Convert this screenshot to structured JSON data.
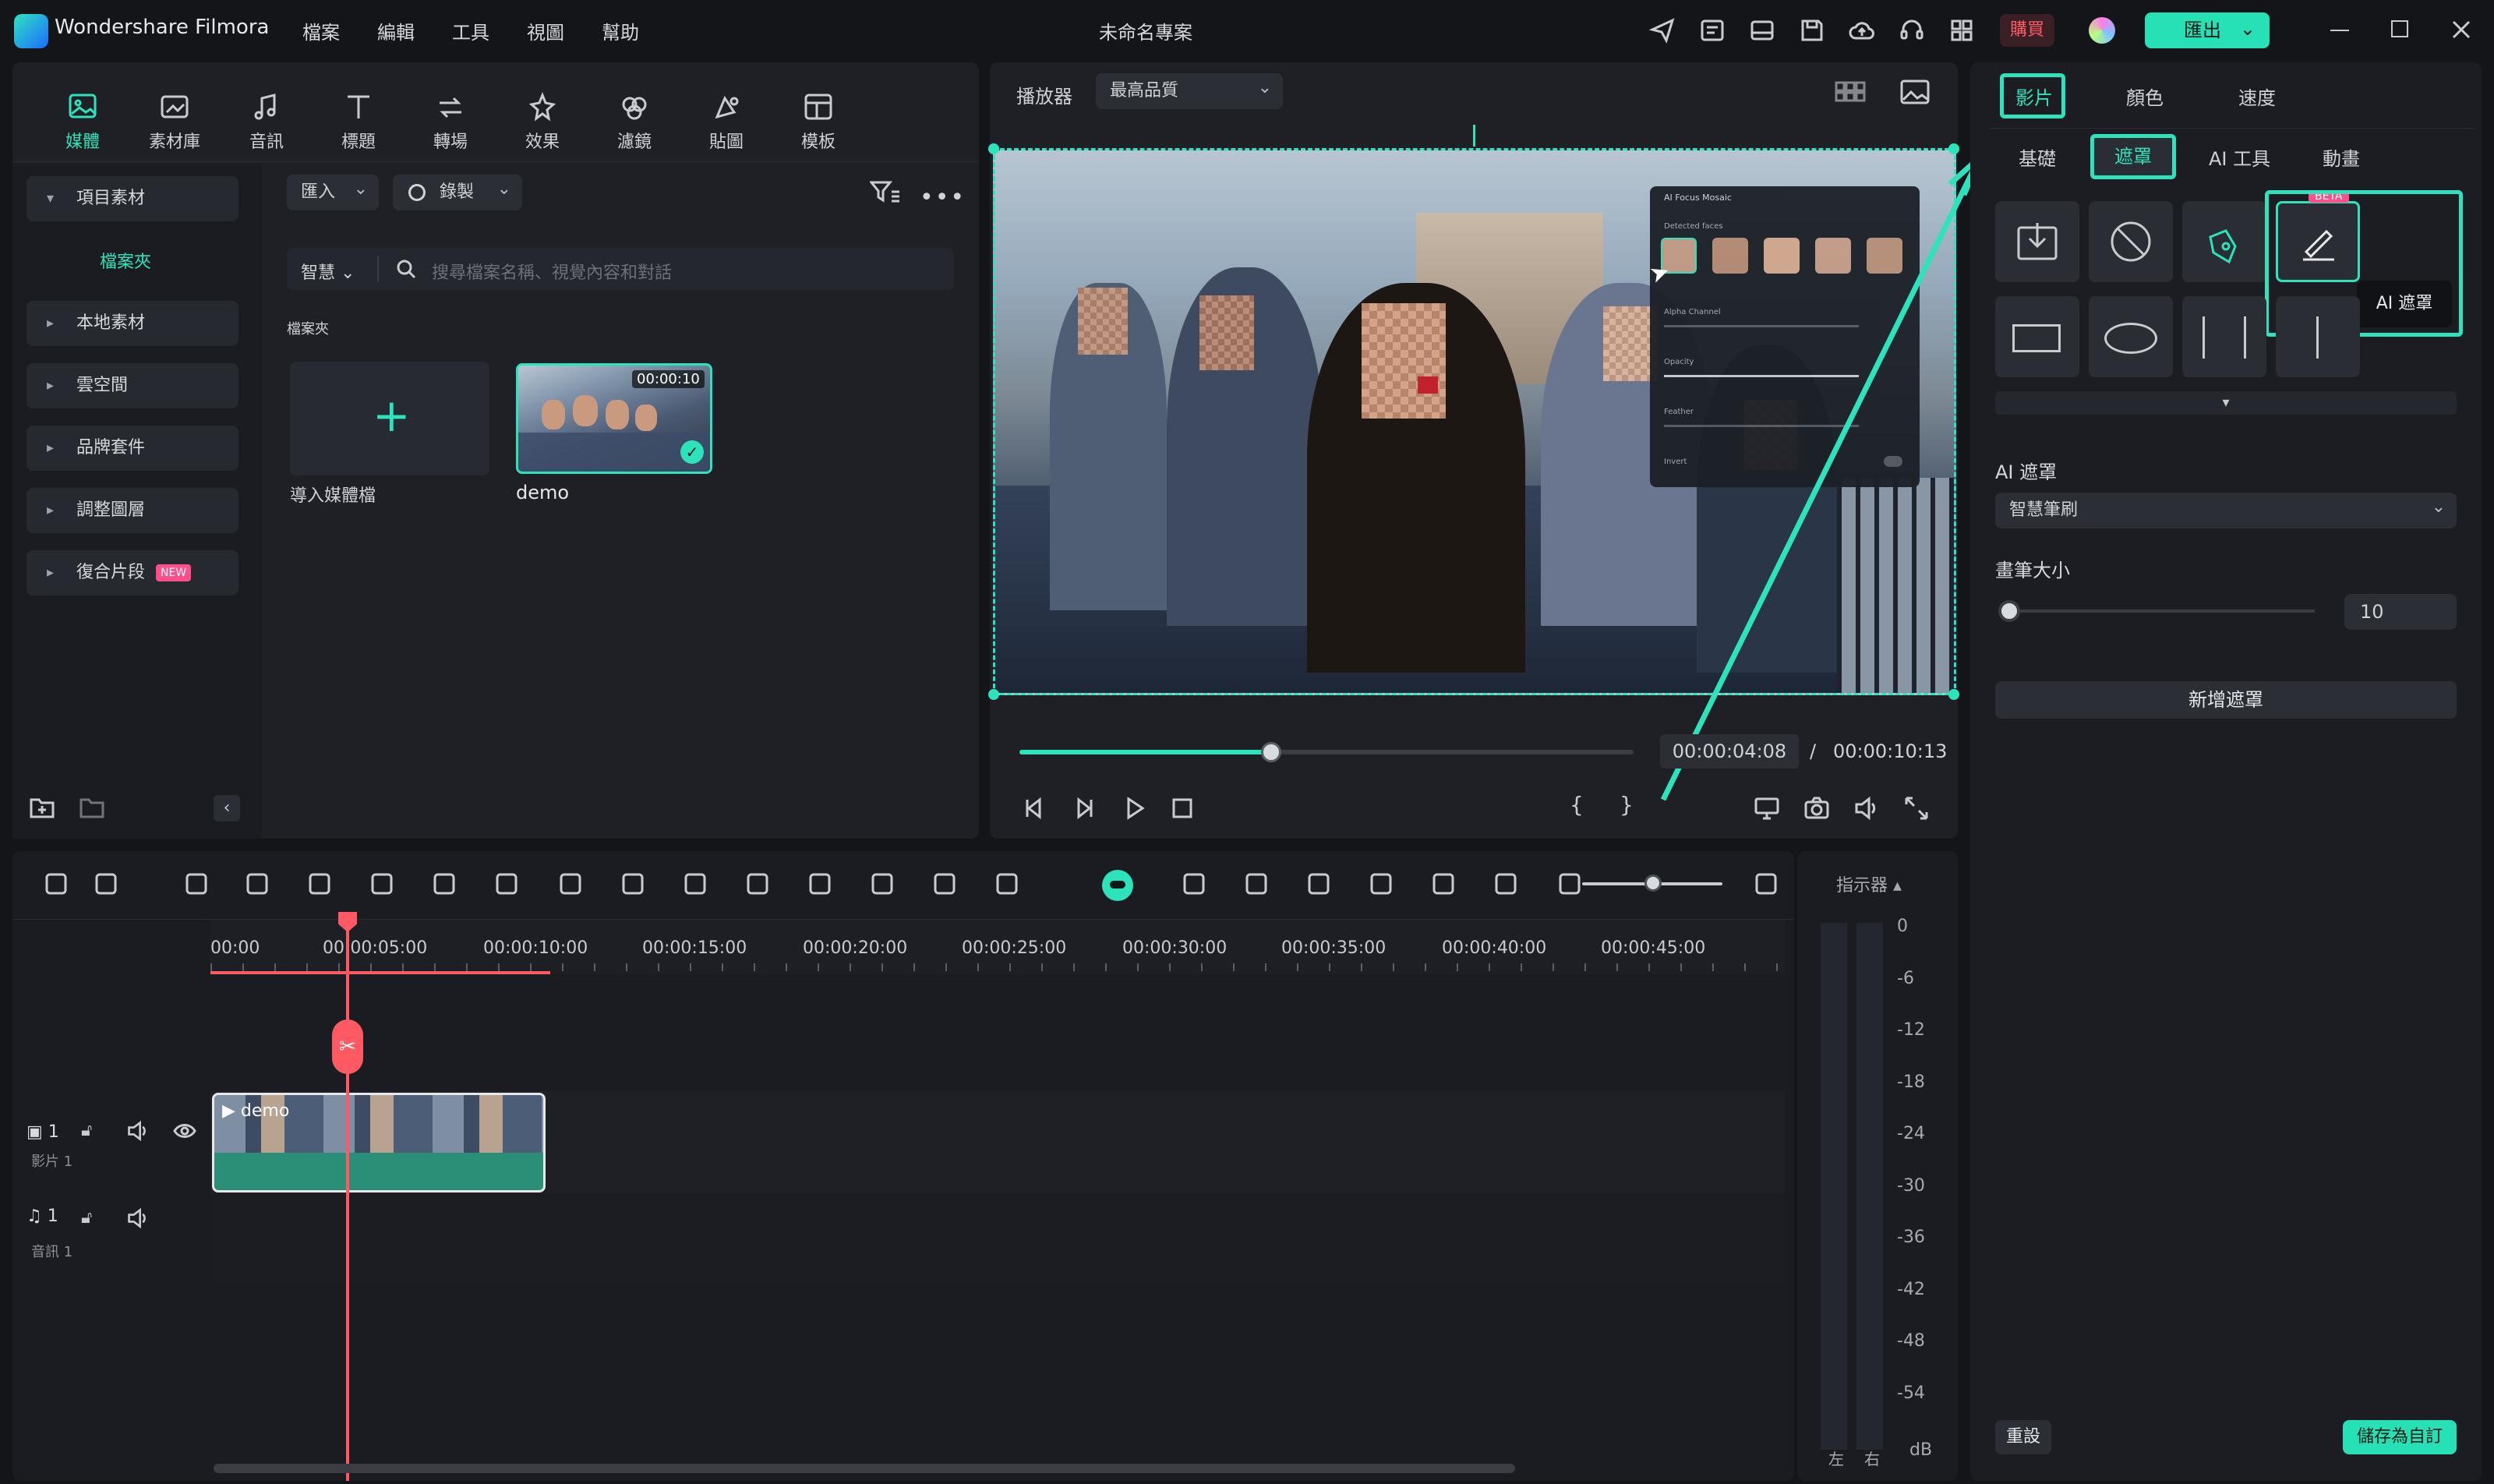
{
  "app": {
    "name": "Wondershare Filmora",
    "project_title": "未命名專案",
    "buy_label": "購買",
    "export_label": "匯出"
  },
  "menu": [
    "檔案",
    "編輯",
    "工具",
    "視圖",
    "幫助"
  ],
  "media_tools": [
    {
      "label": "媒體",
      "icon": "media-icon"
    },
    {
      "label": "素材庫",
      "icon": "stock-icon"
    },
    {
      "label": "音訊",
      "icon": "music-icon"
    },
    {
      "label": "標題",
      "icon": "title-icon"
    },
    {
      "label": "轉場",
      "icon": "transition-icon"
    },
    {
      "label": "效果",
      "icon": "effects-icon"
    },
    {
      "label": "濾鏡",
      "icon": "filter-icon"
    },
    {
      "label": "貼圖",
      "icon": "sticker-icon"
    },
    {
      "label": "模板",
      "icon": "template-icon"
    }
  ],
  "sidebar": {
    "project_media": "項目素材",
    "folder": "檔案夾",
    "items": [
      "本地素材",
      "雲空間",
      "品牌套件",
      "調整圖層",
      "復合片段"
    ],
    "new_badge": "NEW"
  },
  "media": {
    "import_label": "匯入",
    "record_label": "錄製",
    "smart_label": "智慧",
    "search_placeholder": "搜尋檔案名稱、視覺內容和對話",
    "folder_heading": "檔案夾",
    "import_tile_label": "導入媒體檔",
    "clip_name": "demo",
    "clip_duration": "00:00:10"
  },
  "player": {
    "label": "播放器",
    "quality": "最高品質",
    "current_time": "00:00:04:08",
    "separator": "/",
    "total_time": "00:00:10:13",
    "progress": 0.41
  },
  "ai_panel": {
    "title": "AI Focus Mosaic",
    "detected": "Detected faces",
    "rows": [
      "Alpha Channel",
      "Opacity",
      "Feather",
      "Invert"
    ]
  },
  "right_panel": {
    "tabs": [
      "影片",
      "顏色",
      "速度"
    ],
    "subtabs": [
      "基礎",
      "遮罩",
      "AI 工具",
      "動畫"
    ],
    "beta_badge": "BETA",
    "tooltip": "AI 遮罩",
    "ai_mask_label": "AI 遮罩",
    "ai_mask_mode": "智慧筆刷",
    "brush_size_label": "畫筆大小",
    "brush_size_value": "10",
    "add_mask": "新增遮罩",
    "reset": "重設",
    "save_custom": "儲存為自訂"
  },
  "timeline": {
    "ruler": [
      "00:00",
      "00:00:05:00",
      "00:00:10:00",
      "00:00:15:00",
      "00:00:20:00",
      "00:00:25:00",
      "00:00:30:00",
      "00:00:35:00",
      "00:00:40:00",
      "00:00:45:00"
    ],
    "video_track": {
      "index": "1",
      "name": "影片 1"
    },
    "audio_track": {
      "index": "1",
      "name": "音訊 1"
    },
    "clip_name": "demo"
  },
  "meter": {
    "label": "指示器",
    "scale": [
      "0",
      "-6",
      "-12",
      "-18",
      "-24",
      "-30",
      "-36",
      "-42",
      "-48",
      "-54"
    ],
    "unit": "dB",
    "left": "左",
    "right": "右"
  },
  "colors": {
    "accent": "#2ce3bb",
    "playhead": "#ff5a64",
    "bg": "#141519",
    "panel": "#1e2026"
  }
}
